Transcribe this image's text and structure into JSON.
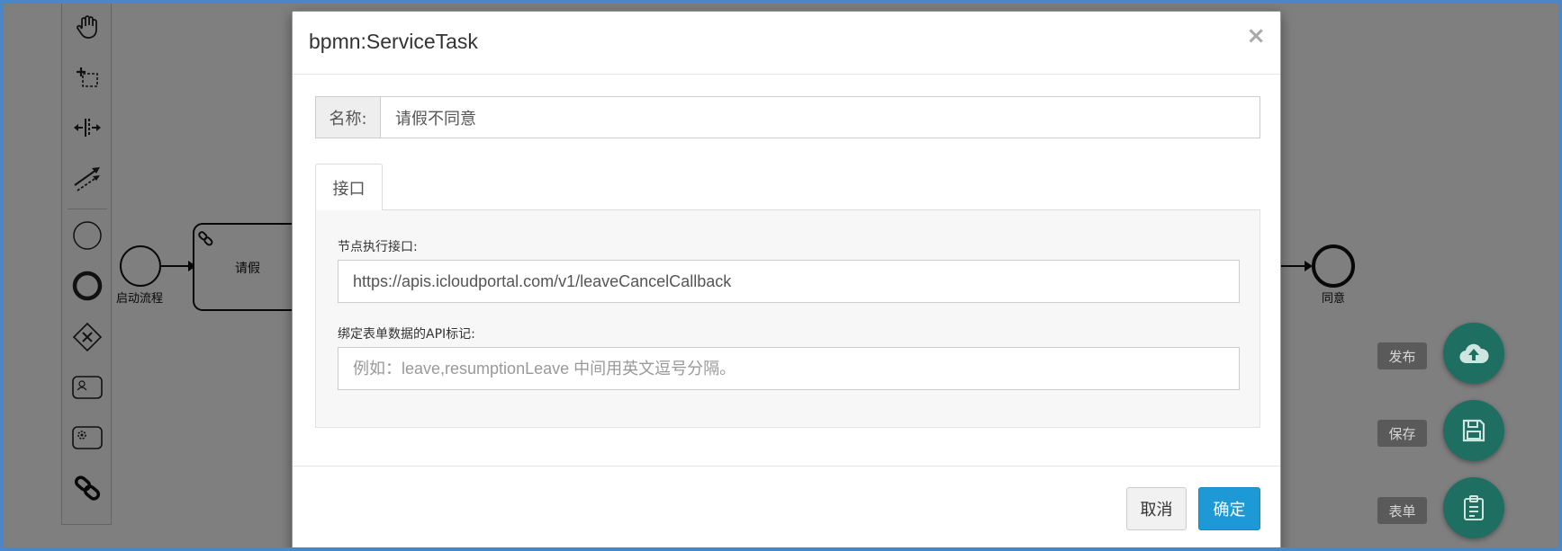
{
  "diagram": {
    "start_event_label": "启动流程",
    "task_label": "请假",
    "end_event_label": "同意"
  },
  "palette": {
    "tools": [
      "hand-tool-icon",
      "lasso-tool-icon",
      "space-tool-icon",
      "global-connect-icon",
      "start-event-icon",
      "end-event-icon",
      "gateway-icon",
      "user-task-icon",
      "service-task-icon",
      "link-icon"
    ]
  },
  "actions": {
    "publish_label": "发布",
    "save_label": "保存",
    "form_label": "表单"
  },
  "modal": {
    "title": "bpmn:ServiceTask",
    "close_symbol": "×",
    "name_addon": "名称:",
    "name_value": "请假不同意",
    "tab_label": "接口",
    "endpoint_label": "节点执行接口:",
    "endpoint_value": "https://apis.icloudportal.com/v1/leaveCancelCallback",
    "api_key_label": "绑定表单数据的API标记:",
    "api_key_value": "",
    "api_key_placeholder": "例如：leave,resumptionLeave 中间用英文逗号分隔。",
    "cancel_label": "取消",
    "ok_label": "确定"
  },
  "colors": {
    "frame_border": "#4a86c8",
    "fab_bg": "#1e6f62",
    "primary_button": "#1d9ad6"
  }
}
